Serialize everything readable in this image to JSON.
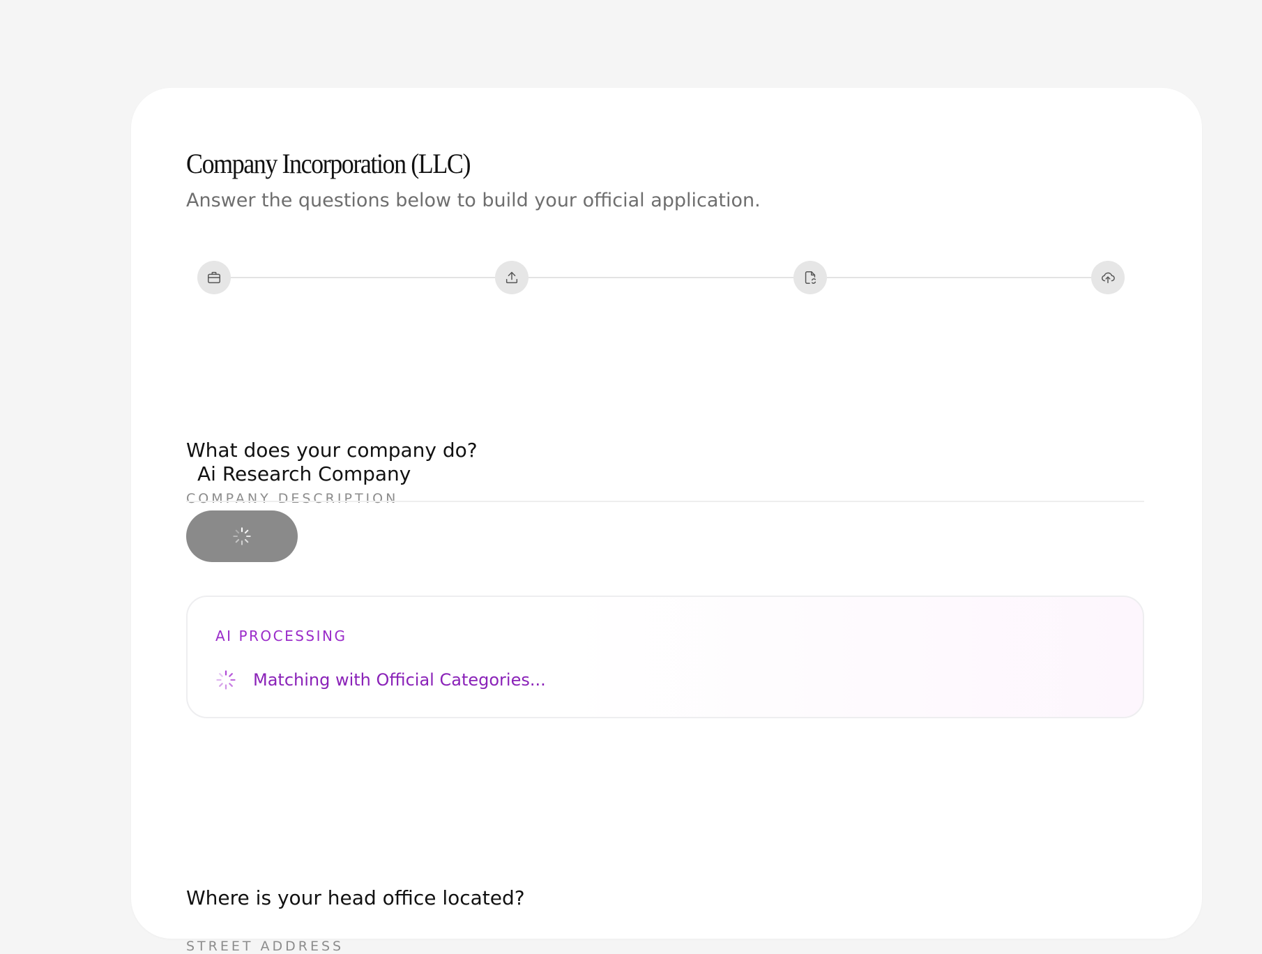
{
  "form": {
    "title": "Company Incorporation (LLC)",
    "subtitle": "Answer the questions below to build your official application."
  },
  "stepper": {
    "steps": [
      {
        "icon": "briefcase-icon"
      },
      {
        "icon": "upload-icon"
      },
      {
        "icon": "document-sync-icon"
      },
      {
        "icon": "cloud-upload-icon"
      }
    ]
  },
  "company_section": {
    "question": "What does your company do?",
    "field_label": "COMPANY DESCRIPTION",
    "value": "Ai Research Company"
  },
  "submit_button": {
    "icon": "loading-spinner-icon",
    "background": "#8a8a8a"
  },
  "ai_processing": {
    "label": "AI PROCESSING",
    "status": "Matching with Official Categories...",
    "accent_color": "#8a22b8"
  },
  "address_section": {
    "question": "Where is your head office located?",
    "field_label": "STREET ADDRESS"
  }
}
